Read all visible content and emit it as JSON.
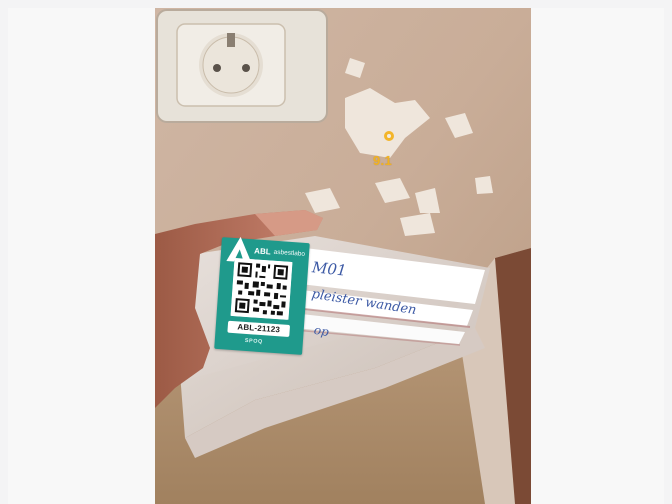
{
  "photo": {
    "scene": "Hand holding a labelled zip-lock asbestos sample bag below a damaged wall socket",
    "marker": {
      "id_label": "9.1",
      "color": "#f3b52a"
    },
    "sample_label": {
      "brand_name": "ABL",
      "brand_subtitle": "asbestlabo",
      "sample_code": "ABL-21123",
      "maker_tag": "SPOQ",
      "card_color": "#1f9a8c"
    },
    "handwritten_note": {
      "line1": "M01",
      "line2": "pleister wanden",
      "line3": "op"
    }
  },
  "colors": {
    "page_background": "#f4f4f5",
    "wall": "#cdb4a2",
    "socket": "#ece9e2"
  }
}
